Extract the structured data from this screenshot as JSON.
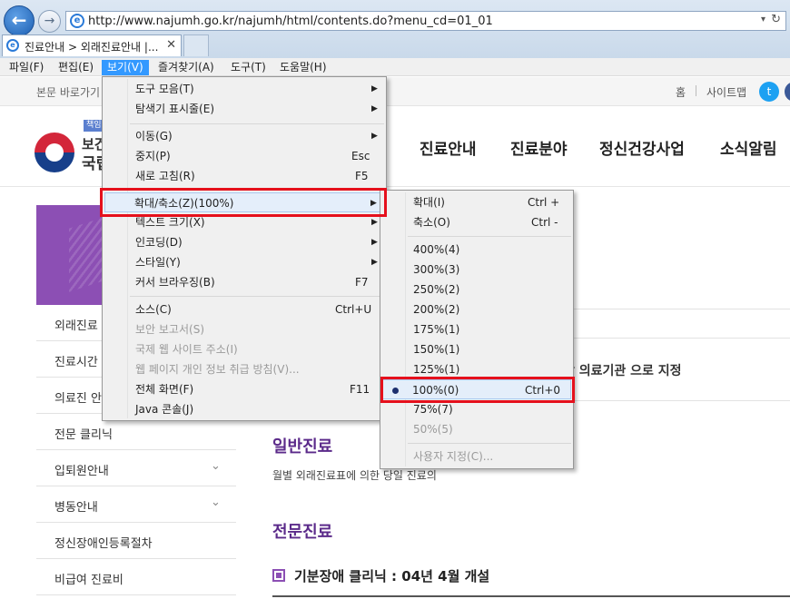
{
  "browser": {
    "back_icon": "←",
    "forward_icon": "→",
    "url": "http://www.najumh.go.kr/najumh/html/contents.do?menu_cd=01_01",
    "tab_title": "진료안내 > 외래진료안내 |...",
    "close_icon": "✕",
    "dropdown_icon": "▾",
    "refresh_icon": "↻",
    "ie_icon": "e"
  },
  "menubar": [
    {
      "label": "파일(F)"
    },
    {
      "label": "편집(E)"
    },
    {
      "label": "보기(V)"
    },
    {
      "label": "즐겨찾기(A)"
    },
    {
      "label": "도구(T)"
    },
    {
      "label": "도움말(H)"
    }
  ],
  "view_menu": {
    "items": [
      {
        "label": "도구 모음(T)",
        "shortcut": "",
        "submenu": true
      },
      {
        "label": "탐색기 표시줄(E)",
        "shortcut": "",
        "submenu": true
      },
      {
        "label": "이동(G)",
        "shortcut": "",
        "submenu": true
      },
      {
        "label": "중지(P)",
        "shortcut": "Esc"
      },
      {
        "label": "새로 고침(R)",
        "shortcut": "F5"
      },
      {
        "label": "확대/축소(Z)(100%)",
        "shortcut": "",
        "submenu": true
      },
      {
        "label": "텍스트 크기(X)",
        "shortcut": "",
        "submenu": true
      },
      {
        "label": "인코딩(D)",
        "shortcut": "",
        "submenu": true
      },
      {
        "label": "스타일(Y)",
        "shortcut": "",
        "submenu": true
      },
      {
        "label": "커서 브라우징(B)",
        "shortcut": "F7"
      },
      {
        "label": "소스(C)",
        "shortcut": "Ctrl+U"
      },
      {
        "label": "보안 보고서(S)",
        "shortcut": ""
      },
      {
        "label": "국제 웹 사이트 주소(I)",
        "shortcut": ""
      },
      {
        "label": "웹 페이지 개인 정보 취급 방침(V)...",
        "shortcut": ""
      },
      {
        "label": "전체 화면(F)",
        "shortcut": "F11"
      },
      {
        "label": "Java 콘솔(J)",
        "shortcut": ""
      }
    ],
    "arrow": "▶"
  },
  "zoom_menu": {
    "items": [
      {
        "label": "확대(I)",
        "shortcut": "Ctrl +"
      },
      {
        "label": "축소(O)",
        "shortcut": "Ctrl -"
      },
      {
        "label": "400%(4)",
        "shortcut": ""
      },
      {
        "label": "300%(3)",
        "shortcut": ""
      },
      {
        "label": "250%(2)",
        "shortcut": ""
      },
      {
        "label": "200%(2)",
        "shortcut": ""
      },
      {
        "label": "175%(1)",
        "shortcut": ""
      },
      {
        "label": "150%(1)",
        "shortcut": ""
      },
      {
        "label": "125%(1)",
        "shortcut": ""
      },
      {
        "label": "100%(0)",
        "shortcut": "Ctrl+0"
      },
      {
        "label": "75%(7)",
        "shortcut": ""
      },
      {
        "label": "50%(5)",
        "shortcut": ""
      },
      {
        "label": "사용자 지정(C)...",
        "shortcut": ""
      }
    ],
    "selected": "100%(0)"
  },
  "site": {
    "skip_link": "본문 바로가기",
    "home": "홈",
    "sitemap": "사이트맵",
    "badge": "책임",
    "org_line1": "보건",
    "org_line2": "국립",
    "gnb": [
      {
        "label": "진료안내"
      },
      {
        "label": "진료분야"
      },
      {
        "label": "정신건강사업"
      },
      {
        "label": "소식알림"
      }
    ],
    "lnb": [
      {
        "label": "외래진료"
      },
      {
        "label": "진료시간"
      },
      {
        "label": "의료진 안"
      },
      {
        "label": "전문 클리닉"
      },
      {
        "label": "입퇴원안내",
        "expand": "⌄"
      },
      {
        "label": "병동안내",
        "expand": "⌄"
      },
      {
        "label": "정신장애인등록절차"
      },
      {
        "label": "비급여 진료비"
      }
    ],
    "designation": "상 의료기관 으로 지정",
    "general_title": "일반진료",
    "general_desc": "월별 외래진료표에 의한 당일 진료의",
    "special_title": "전문진료",
    "clinic_title": "기분장애 클리닉 : 04년 4월 개설"
  },
  "colors": {
    "accent": "#3399ff",
    "highlight_box": "#e5101c",
    "brand_purple": "#8c4fb4",
    "heading_purple": "#5b2a8a"
  }
}
